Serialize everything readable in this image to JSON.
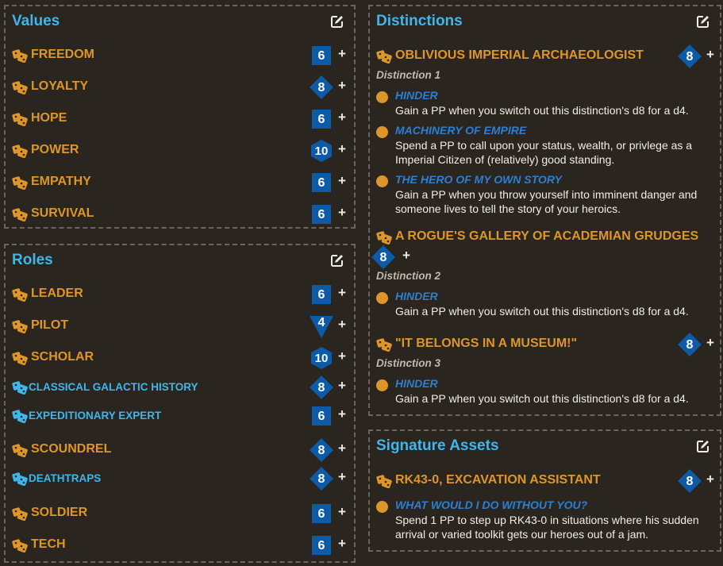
{
  "values": {
    "title": "Values",
    "items": [
      {
        "label": "FREEDOM",
        "die": "6",
        "plus": "+"
      },
      {
        "label": "LOYALTY",
        "die": "8",
        "plus": "+"
      },
      {
        "label": "HOPE",
        "die": "6",
        "plus": "+"
      },
      {
        "label": "POWER",
        "die": "10",
        "plus": "+"
      },
      {
        "label": "EMPATHY",
        "die": "6",
        "plus": "+"
      },
      {
        "label": "SURVIVAL",
        "die": "6",
        "plus": "+"
      }
    ]
  },
  "roles": {
    "title": "Roles",
    "items": [
      {
        "label": "LEADER",
        "die": "6",
        "plus": "+"
      },
      {
        "label": "PILOT",
        "die": "4",
        "plus": "+"
      },
      {
        "label": "SCHOLAR",
        "die": "10",
        "plus": "+"
      },
      {
        "label": "CLASSICAL GALACTIC HISTORY",
        "die": "8",
        "plus": "+"
      },
      {
        "label": "EXPEDITIONARY EXPERT",
        "die": "6",
        "plus": "+"
      },
      {
        "label": "SCOUNDREL",
        "die": "8",
        "plus": "+"
      },
      {
        "label": "DEATHTRAPS",
        "die": "8",
        "plus": "+"
      },
      {
        "label": "SOLDIER",
        "die": "6",
        "plus": "+"
      },
      {
        "label": "TECH",
        "die": "6",
        "plus": "+"
      }
    ]
  },
  "distinctions": {
    "title": "Distinctions",
    "items": [
      {
        "label": "OBLIVIOUS IMPERIAL ARCHAEOLOGIST",
        "die": "8",
        "plus": "+",
        "sublabel": "Distinction 1",
        "triggers": [
          {
            "name": "HINDER",
            "desc": "Gain a PP when you switch out this distinction's d8 for a d4."
          },
          {
            "name": "MACHINERY OF EMPIRE",
            "desc": "Spend a PP to call upon your status, wealth, or privlege as a Imperial Citizen of (relatively) good standing."
          },
          {
            "name": "THE HERO OF MY OWN STORY",
            "desc": "Gain a PP when you throw yourself into imminent danger and someone lives to tell the story of your heroics."
          }
        ]
      },
      {
        "label": "A ROGUE'S GALLERY OF ACADEMIAN GRUDGES",
        "die": "8",
        "plus": "+",
        "sublabel": "Distinction 2",
        "triggers": [
          {
            "name": "HINDER",
            "desc": "Gain a PP when you switch out this distinction's d8 for a d4."
          }
        ]
      },
      {
        "label": "\"IT BELONGS IN A MUSEUM!\"",
        "die": "8",
        "plus": "+",
        "sublabel": "Distinction 3",
        "triggers": [
          {
            "name": "HINDER",
            "desc": "Gain a PP when you switch out this distinction's d8 for a d4."
          }
        ]
      }
    ]
  },
  "signature_assets": {
    "title": "Signature Assets",
    "items": [
      {
        "label": "RK43-0, EXCAVATION ASSISTANT",
        "die": "8",
        "plus": "+",
        "triggers": [
          {
            "name": "WHAT WOULD I DO WITHOUT YOU?",
            "desc": "Spend 1 PP to step up RK43-0 in situations where his sudden arrival or varied toolkit gets our heroes out of a jam."
          }
        ]
      }
    ]
  },
  "colors": {
    "accent_blue": "#3fb6ec",
    "trait_orange": "#dc962b",
    "die_blue": "#0d5aa7",
    "trigger_blue": "#2f7fd0",
    "background": "#2a251f"
  },
  "icons": {
    "edit": "edit-icon",
    "trait": "dice-icon",
    "sub_trait": "dice-icon-blue",
    "trigger": "dot-icon"
  }
}
